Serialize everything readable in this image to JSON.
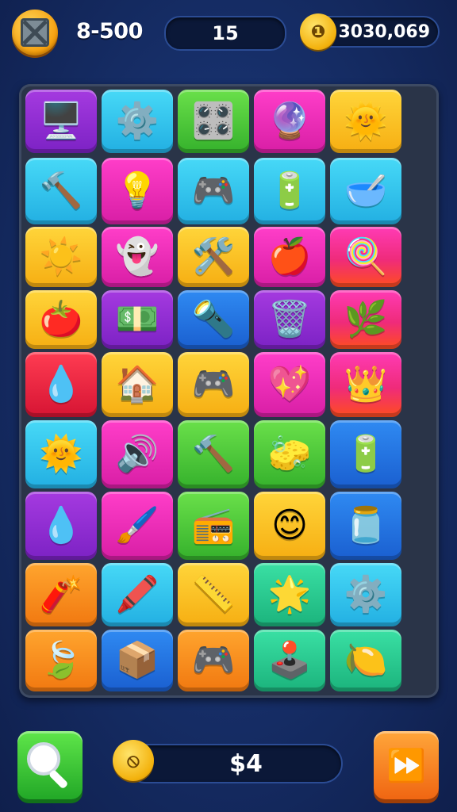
{
  "hud": {
    "menu_icon": "gear-frame-icon",
    "score": "8-500",
    "moves": "15",
    "coin_icon": "coin-icon",
    "coins": "3030,069"
  },
  "board": {
    "tiles": [
      {
        "id": "r1c1",
        "color": "purple",
        "icon": "monitor-icon",
        "glyph": "🖥️"
      },
      {
        "id": "r1c2",
        "color": "cyan",
        "icon": "gear-icon",
        "glyph": "⚙️"
      },
      {
        "id": "r1c3",
        "color": "green",
        "icon": "control-panel-icon",
        "glyph": "🎛️"
      },
      {
        "id": "r1c4",
        "color": "pink",
        "icon": "gear-icon",
        "glyph": "🔮"
      },
      {
        "id": "r1c5",
        "color": "yellow",
        "icon": "sun-icon",
        "glyph": "🌞"
      },
      {
        "id": "r2c1",
        "color": "cyan",
        "icon": "hammer-icon",
        "glyph": "🔨"
      },
      {
        "id": "r2c2",
        "color": "pink",
        "icon": "lightbulb-icon",
        "glyph": "💡"
      },
      {
        "id": "r2c3",
        "color": "cyan",
        "icon": "gamepad-icon",
        "glyph": "🎮"
      },
      {
        "id": "r2c4",
        "color": "cyan",
        "icon": "battery-icon",
        "glyph": "🔋"
      },
      {
        "id": "r2c5",
        "color": "cyan",
        "icon": "bowl-icon",
        "glyph": "🥣"
      },
      {
        "id": "r3c1",
        "color": "yellow",
        "icon": "sun-icon",
        "glyph": "☀️"
      },
      {
        "id": "r3c2",
        "color": "pink",
        "icon": "ghost-icon",
        "glyph": "👻"
      },
      {
        "id": "r3c3",
        "color": "yellow",
        "icon": "tools-icon",
        "glyph": "🛠️"
      },
      {
        "id": "r3c4",
        "color": "pink",
        "icon": "apple-icon",
        "glyph": "🍎"
      },
      {
        "id": "r3c5",
        "color": "grad-tall",
        "icon": "candy-icon",
        "glyph": "🍭"
      },
      {
        "id": "r4c1",
        "color": "yellow",
        "icon": "apple-icon",
        "glyph": "🍅"
      },
      {
        "id": "r4c2",
        "color": "purple",
        "icon": "cash-icon",
        "glyph": "💵"
      },
      {
        "id": "r4c3",
        "color": "blue",
        "icon": "flashlight-icon",
        "glyph": "🔦"
      },
      {
        "id": "r4c4",
        "color": "purple",
        "icon": "trash-can-icon",
        "glyph": "🗑️"
      },
      {
        "id": "r4c5",
        "color": "grad-tall",
        "icon": "flower-icon",
        "glyph": "🌿"
      },
      {
        "id": "r5c1",
        "color": "red",
        "icon": "water-bowl-icon",
        "glyph": "💧"
      },
      {
        "id": "r5c2",
        "color": "yellow",
        "icon": "house-icon",
        "glyph": "🏠"
      },
      {
        "id": "r5c3",
        "color": "yellow",
        "icon": "gamepad-icon",
        "glyph": "🎮"
      },
      {
        "id": "r5c4",
        "color": "pink",
        "icon": "heart-icon",
        "glyph": "💖"
      },
      {
        "id": "r5c5",
        "color": "grad-tall",
        "icon": "crown-icon",
        "glyph": "👑"
      },
      {
        "id": "r6c1",
        "color": "cyan",
        "icon": "sun-icon",
        "glyph": "🌞"
      },
      {
        "id": "r6c2",
        "color": "pink",
        "icon": "speaker-icon",
        "glyph": "🔊"
      },
      {
        "id": "r6c3",
        "color": "green",
        "icon": "hammer-bottle-icon",
        "glyph": "🔨"
      },
      {
        "id": "r6c4",
        "color": "green",
        "icon": "eraser-icon",
        "glyph": "🧽"
      },
      {
        "id": "r6c5",
        "color": "blue",
        "icon": "battery-icon",
        "glyph": "🔋"
      },
      {
        "id": "r7c1",
        "color": "purple",
        "icon": "droplet-icon",
        "glyph": "💧"
      },
      {
        "id": "r7c2",
        "color": "pink",
        "icon": "paint-brush-icon",
        "glyph": "🖌️"
      },
      {
        "id": "r7c3",
        "color": "green",
        "icon": "record-player-icon",
        "glyph": "📻"
      },
      {
        "id": "r7c4",
        "color": "yellow",
        "icon": "face-icon",
        "glyph": "😊"
      },
      {
        "id": "r7c5",
        "color": "blue",
        "icon": "bottle-icon",
        "glyph": "🫙"
      },
      {
        "id": "r8c1",
        "color": "orange",
        "icon": "eraser-icon",
        "glyph": "🧨"
      },
      {
        "id": "r8c2",
        "color": "cyan",
        "icon": "brush-icon",
        "glyph": "🖍️"
      },
      {
        "id": "r8c3",
        "color": "yellow",
        "icon": "eraser-icon",
        "glyph": "📏"
      },
      {
        "id": "r8c4",
        "color": "teal",
        "icon": "sun-icon",
        "glyph": "🌟"
      },
      {
        "id": "r8c5",
        "color": "cyan",
        "icon": "gear-icon",
        "glyph": "⚙️"
      },
      {
        "id": "r9c1",
        "color": "orange",
        "icon": "leaf-icon",
        "glyph": "🍃"
      },
      {
        "id": "r9c2",
        "color": "blue",
        "icon": "box-icon",
        "glyph": "📦"
      },
      {
        "id": "r9c3",
        "color": "orange",
        "icon": "gamepad-icon",
        "glyph": "🎮"
      },
      {
        "id": "r9c4",
        "color": "teal",
        "icon": "controller-icon",
        "glyph": "🕹️"
      },
      {
        "id": "r9c5",
        "color": "teal",
        "icon": "lemon-icon",
        "glyph": "🍋"
      }
    ]
  },
  "footer": {
    "hint_icon": "magnifier-icon",
    "cash_icon": "coin-icon",
    "cash_value": "$4",
    "next_icon": "fast-forward-icon",
    "next_glyph": "⏩"
  }
}
